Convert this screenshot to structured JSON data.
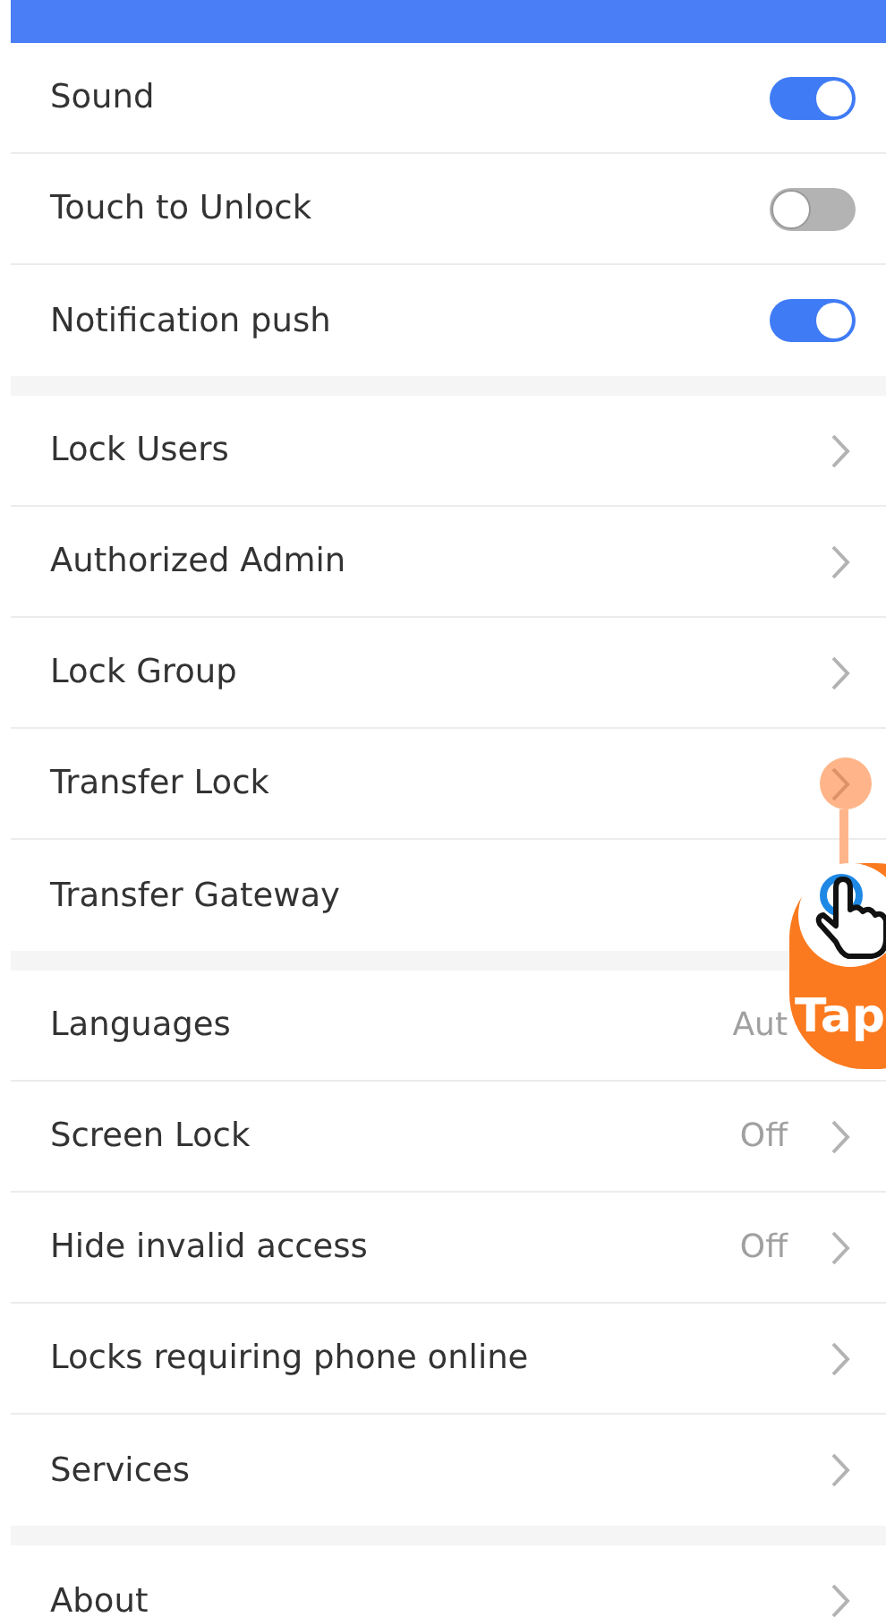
{
  "sections": [
    {
      "rows": [
        {
          "kind": "toggle",
          "label": "Sound",
          "on": true
        },
        {
          "kind": "toggle",
          "label": "Touch to Unlock",
          "on": false
        },
        {
          "kind": "toggle",
          "label": "Notification push",
          "on": true
        }
      ]
    },
    {
      "rows": [
        {
          "kind": "link",
          "label": "Lock Users"
        },
        {
          "kind": "link",
          "label": "Authorized Admin"
        },
        {
          "kind": "link",
          "label": "Lock Group"
        },
        {
          "kind": "link",
          "label": "Transfer Lock"
        },
        {
          "kind": "link",
          "label": "Transfer Gateway"
        }
      ]
    },
    {
      "rows": [
        {
          "kind": "link",
          "label": "Languages",
          "value": "Aut"
        },
        {
          "kind": "link",
          "label": "Screen Lock",
          "value": "Off"
        },
        {
          "kind": "link",
          "label": "Hide invalid access",
          "value": "Off"
        },
        {
          "kind": "link",
          "label": "Locks requiring phone online"
        },
        {
          "kind": "link",
          "label": "Services"
        }
      ]
    },
    {
      "rows": [
        {
          "kind": "link",
          "label": "About"
        }
      ]
    }
  ],
  "tap_hint": {
    "label": "Tap"
  }
}
